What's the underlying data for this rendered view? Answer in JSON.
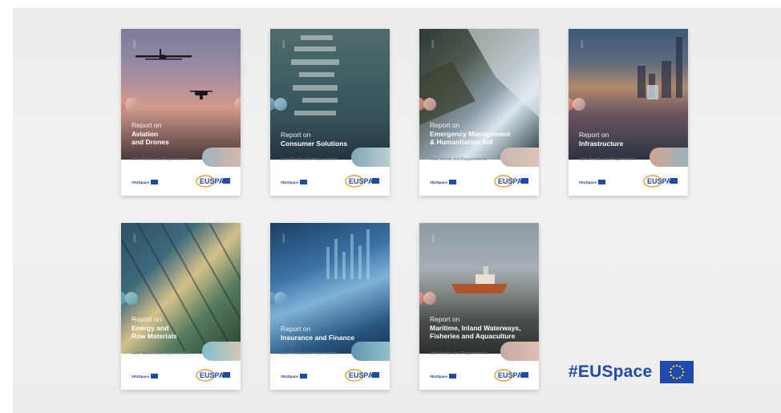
{
  "reports": [
    {
      "pre": "Report on",
      "title_lines": [
        "Aviation",
        "and Drones"
      ],
      "needs": "User Needs and Requirements",
      "year": "2023",
      "hashtag": "#EUSpace",
      "logo": "EUSPA",
      "pill": [
        "#9fb3c0",
        "#e0b9a8"
      ]
    },
    {
      "pre": "Report on",
      "title_lines": [
        "Consumer Solutions"
      ],
      "needs": "User Needs and Requirements",
      "year": "2023",
      "hashtag": "#EUSpace",
      "logo": "EUSPA",
      "pill": [
        "#7fa7b5",
        "#c9d6dc"
      ]
    },
    {
      "pre": "Report on",
      "title_lines": [
        "Emergency Management",
        "& Humanitarian Aid"
      ],
      "needs": "User Needs and Requirements",
      "year": "2023",
      "hashtag": "#EUSpace",
      "logo": "EUSPA",
      "pill": [
        "#c9b6b3",
        "#e3c7b7"
      ]
    },
    {
      "pre": "Report on",
      "title_lines": [
        "Infrastructure"
      ],
      "needs": "User Needs and Requirements",
      "year": "2023",
      "hashtag": "#EUSpace",
      "logo": "EUSPA",
      "pill": [
        "#d2a48f",
        "#8fb5c6"
      ]
    },
    {
      "pre": "Report on",
      "title_lines": [
        "Energy and",
        "Raw Materials"
      ],
      "needs": "User Needs and Requirements",
      "year": "2023",
      "hashtag": "#EUSpace",
      "logo": "EUSPA",
      "pill": [
        "#7fbfcf",
        "#e5c7b2"
      ]
    },
    {
      "pre": "Report on",
      "title_lines": [
        "Insurance and Finance"
      ],
      "needs": "User Needs and Requirements",
      "year": "2023",
      "hashtag": "#EUSpace",
      "logo": "EUSPA",
      "pill": [
        "#5f97b1",
        "#9fc7d6"
      ]
    },
    {
      "pre": "Report on",
      "title_lines": [
        "Maritime, Inland Waterways,",
        "Fisheries and Aquaculture"
      ],
      "needs": "User Needs and Requirements",
      "year": "2023",
      "hashtag": "#EUSpace",
      "logo": "EUSPA",
      "pill": [
        "#c4aaa6",
        "#e3c3b3"
      ]
    }
  ],
  "campaign": {
    "hashtag": "#EUSpace"
  },
  "colors": {
    "brand_blue": "#1e4ba8",
    "flag_star": "#ffcc00"
  }
}
